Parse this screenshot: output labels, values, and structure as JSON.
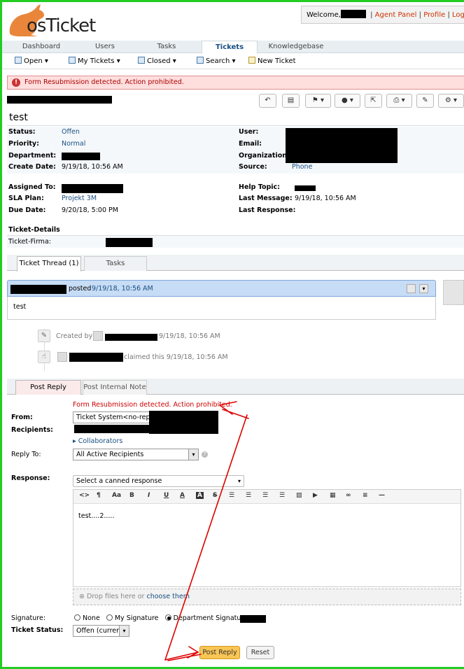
{
  "logo": {
    "text": "osTicket"
  },
  "header": {
    "welcome": "Welcome,",
    "agent_panel": "Agent Panel",
    "profile": "Profile",
    "logout": "Log Out",
    "sep": "|"
  },
  "nav": {
    "tabs": [
      "Dashboard",
      "Users",
      "Tasks",
      "Tickets",
      "Knowledgebase"
    ],
    "active": "Tickets"
  },
  "subnav": {
    "items": [
      "Open",
      "My Tickets",
      "Closed",
      "Search",
      "New Ticket"
    ]
  },
  "alert": {
    "text": "Form Resubmission detected. Action prohibited."
  },
  "ticket": {
    "title": "test",
    "left_fields": [
      {
        "label": "Status:",
        "value": "Offen"
      },
      {
        "label": "Priority:",
        "value": "Normal"
      },
      {
        "label": "Department:",
        "value": ""
      },
      {
        "label": "Create Date:",
        "value": "9/19/18, 10:56 AM"
      }
    ],
    "right_fields": [
      {
        "label": "User:",
        "value": ""
      },
      {
        "label": "Email:",
        "value": ""
      },
      {
        "label": "Organization:",
        "value": ""
      },
      {
        "label": "Source:",
        "value": "Phone"
      }
    ],
    "left_fields2": [
      {
        "label": "Assigned To:",
        "value": ""
      },
      {
        "label": "SLA Plan:",
        "value": "Projekt 3M"
      },
      {
        "label": "Due Date:",
        "value": "9/20/18, 5:00 PM"
      }
    ],
    "right_fields2": [
      {
        "label": "Help Topic:",
        "value": ""
      },
      {
        "label": "Last Message:",
        "value": "9/19/18, 10:56 AM"
      },
      {
        "label": "Last Response:",
        "value": ""
      }
    ],
    "details_heading": "Ticket-Details",
    "details_field": "Ticket-Firma:"
  },
  "thread_tabs": [
    "Ticket Thread (1)",
    "Tasks"
  ],
  "thread": {
    "posted": "posted",
    "posted_date": "9/19/18, 10:56 AM",
    "body": "test",
    "event1_prefix": "Created by",
    "event1_date": "9/19/18, 10:56 AM",
    "event2_text": "claimed this 9/19/18, 10:56 AM"
  },
  "reply_tabs": [
    "Post Reply",
    "Post Internal Note"
  ],
  "reply": {
    "error": "Form Resubmission detected. Action prohibited.",
    "from_label": "From:",
    "from_value": "Ticket System<no-reply@",
    "recipients_label": "Recipients:",
    "collaborators": "Collaborators",
    "reply_to_label": "Reply To:",
    "reply_to_value": "All Active Recipients",
    "response_label": "Response:",
    "canned_placeholder": "Select a canned response",
    "editor_text": "test....2.....",
    "drop_text": "Drop files here or",
    "choose_text": "choose them",
    "signature_label": "Signature:",
    "sig_options": [
      "None",
      "My Signature",
      "Department Signature"
    ],
    "sig_selected": "Department Signature",
    "status_label": "Ticket Status:",
    "status_value": "Offen (current)",
    "post_button": "Post Reply",
    "reset_button": "Reset"
  },
  "colors": {
    "frame": "#22cc22",
    "annotation": "#dd0000",
    "accent": "#184e81"
  }
}
